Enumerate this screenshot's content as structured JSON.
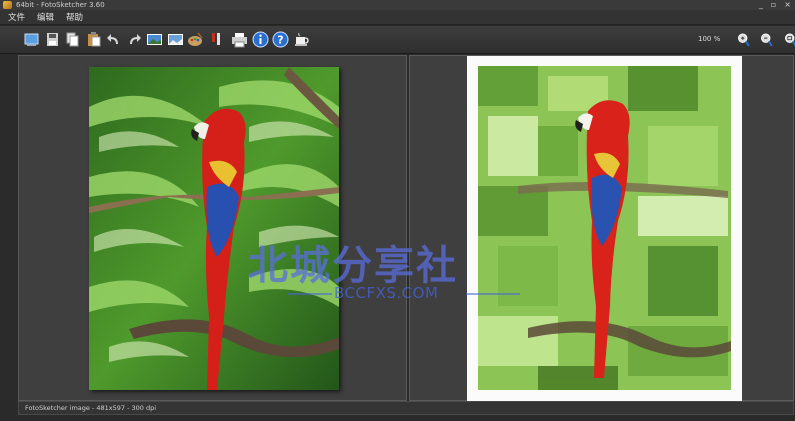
{
  "window": {
    "title": "64bit - FotoSketcher 3.60",
    "buttons": [
      "_",
      "▫",
      "×"
    ]
  },
  "menu": {
    "items": [
      "文件",
      "编辑",
      "帮助"
    ]
  },
  "toolbar": {
    "zoom_value": "100 %"
  },
  "statusbar": {
    "text": "FotoSketcher image - 481x597 - 300 dpi"
  },
  "watermark": {
    "cn": "北城分享社",
    "en": "BCCFXS.COM"
  }
}
